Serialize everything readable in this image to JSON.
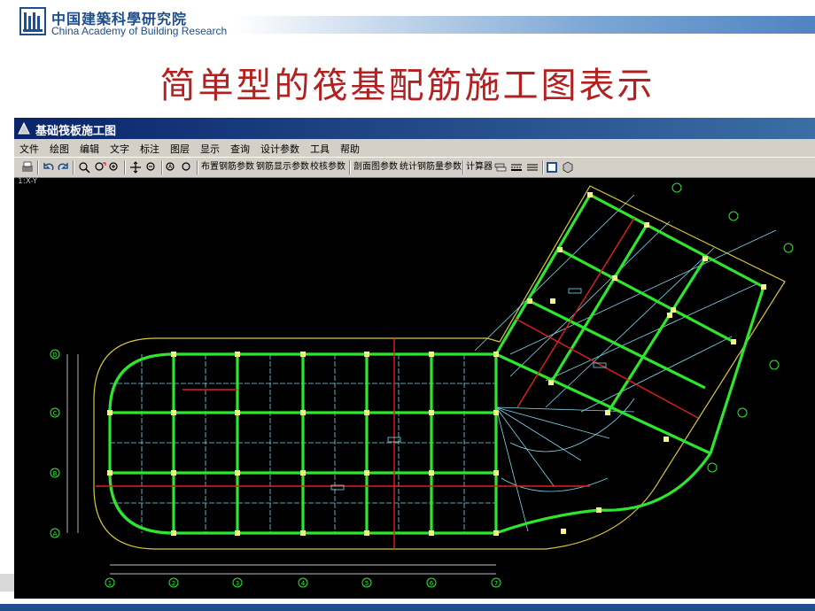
{
  "header": {
    "org_name_cn": "中国建築科學研究院",
    "org_name_en": "China Academy of Building Research"
  },
  "slide_title": "简单型的筏基配筋施工图表示",
  "window": {
    "title": "基础筏板施工图",
    "menu": [
      "文件",
      "绘图",
      "编辑",
      "文字",
      "标注",
      "图层",
      "显示",
      "查询",
      "设计参数",
      "工具",
      "帮助"
    ],
    "toolbar_buttons": [
      "布置钢筋参数",
      "钢筋显示参数",
      "校核参数",
      "剖面图参数",
      "统计钢筋量参数",
      "计算器"
    ],
    "coord_readout": "1:X-Y"
  },
  "colors": {
    "title_red": "#b32020",
    "brand_blue": "#1e4e8c",
    "beam_green": "#2ee62e",
    "grid_cyan": "#7fd6e8",
    "outline_yellow": "#d6c83a",
    "rebar_red": "#e02020",
    "node_yellow": "#f3f58a"
  },
  "axis_labels": {
    "bottom": [
      "1",
      "2",
      "3",
      "4",
      "5",
      "6",
      "7"
    ],
    "left": [
      "D",
      "C",
      "B",
      "A"
    ]
  }
}
